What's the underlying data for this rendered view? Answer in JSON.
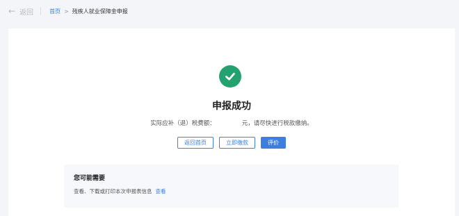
{
  "topbar": {
    "back_icon": "arrow-left-icon",
    "back_label": "返回",
    "breadcrumb": {
      "home": "首页",
      "separator": ">",
      "current": "残疾人就业保障金申报"
    }
  },
  "result": {
    "icon": "check-circle-icon",
    "icon_color": "#23a26f",
    "title": "申报成功",
    "amount_prefix": "实际应补（退）税费额：",
    "amount_value": "",
    "amount_suffix": "元，请尽快进行税款缴纳。"
  },
  "actions": {
    "back_home": "返回首页",
    "pay_now": "立即缴款",
    "rate": "评价"
  },
  "suggest": {
    "title": "您可能需要",
    "text": "查看、下载或打印本次申报表信息",
    "link": "查看"
  },
  "colors": {
    "accent": "#3d7fe0",
    "success": "#23a26f"
  }
}
